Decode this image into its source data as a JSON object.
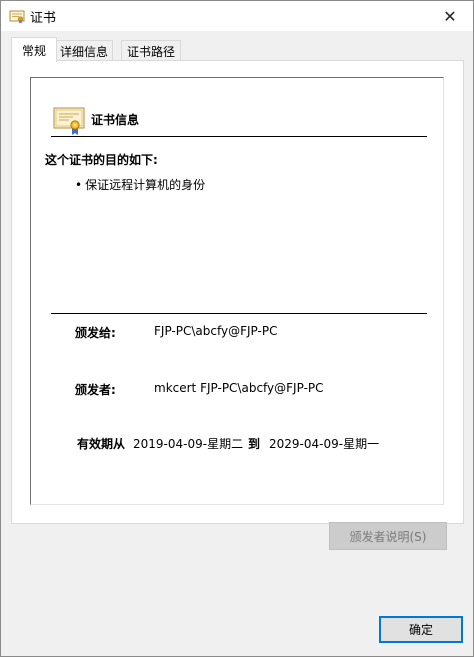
{
  "window": {
    "title": "证书",
    "close_glyph": "✕"
  },
  "tabs": [
    {
      "label": "常规",
      "active": true
    },
    {
      "label": "详细信息",
      "active": false
    },
    {
      "label": "证书路径",
      "active": false
    }
  ],
  "general": {
    "cert_info_title": "证书信息",
    "purpose_heading": "这个证书的目的如下:",
    "purposes": [
      "保证远程计算机的身份"
    ],
    "bullet": "•",
    "issued_to_label": "颁发给:",
    "issued_to_value": "FJP-PC\\abcfy@FJP-PC",
    "issued_by_label": "颁发者:",
    "issued_by_value": "mkcert FJP-PC\\abcfy@FJP-PC",
    "validity_label": "有效期从",
    "valid_from": "2019-04-09-星期二",
    "to_label": "到",
    "valid_to": "2029-04-09-星期一"
  },
  "buttons": {
    "issuer_statement": "颁发者说明(S)",
    "ok": "确定"
  },
  "icons": {
    "title_icon": "certificate-icon",
    "cert_icon": "certificate-ribbon-icon",
    "close_icon": "close-icon"
  },
  "colors": {
    "accent": "#0078d7",
    "disabled_button_bg": "#cccccc",
    "disabled_text": "#7a7a7a"
  }
}
